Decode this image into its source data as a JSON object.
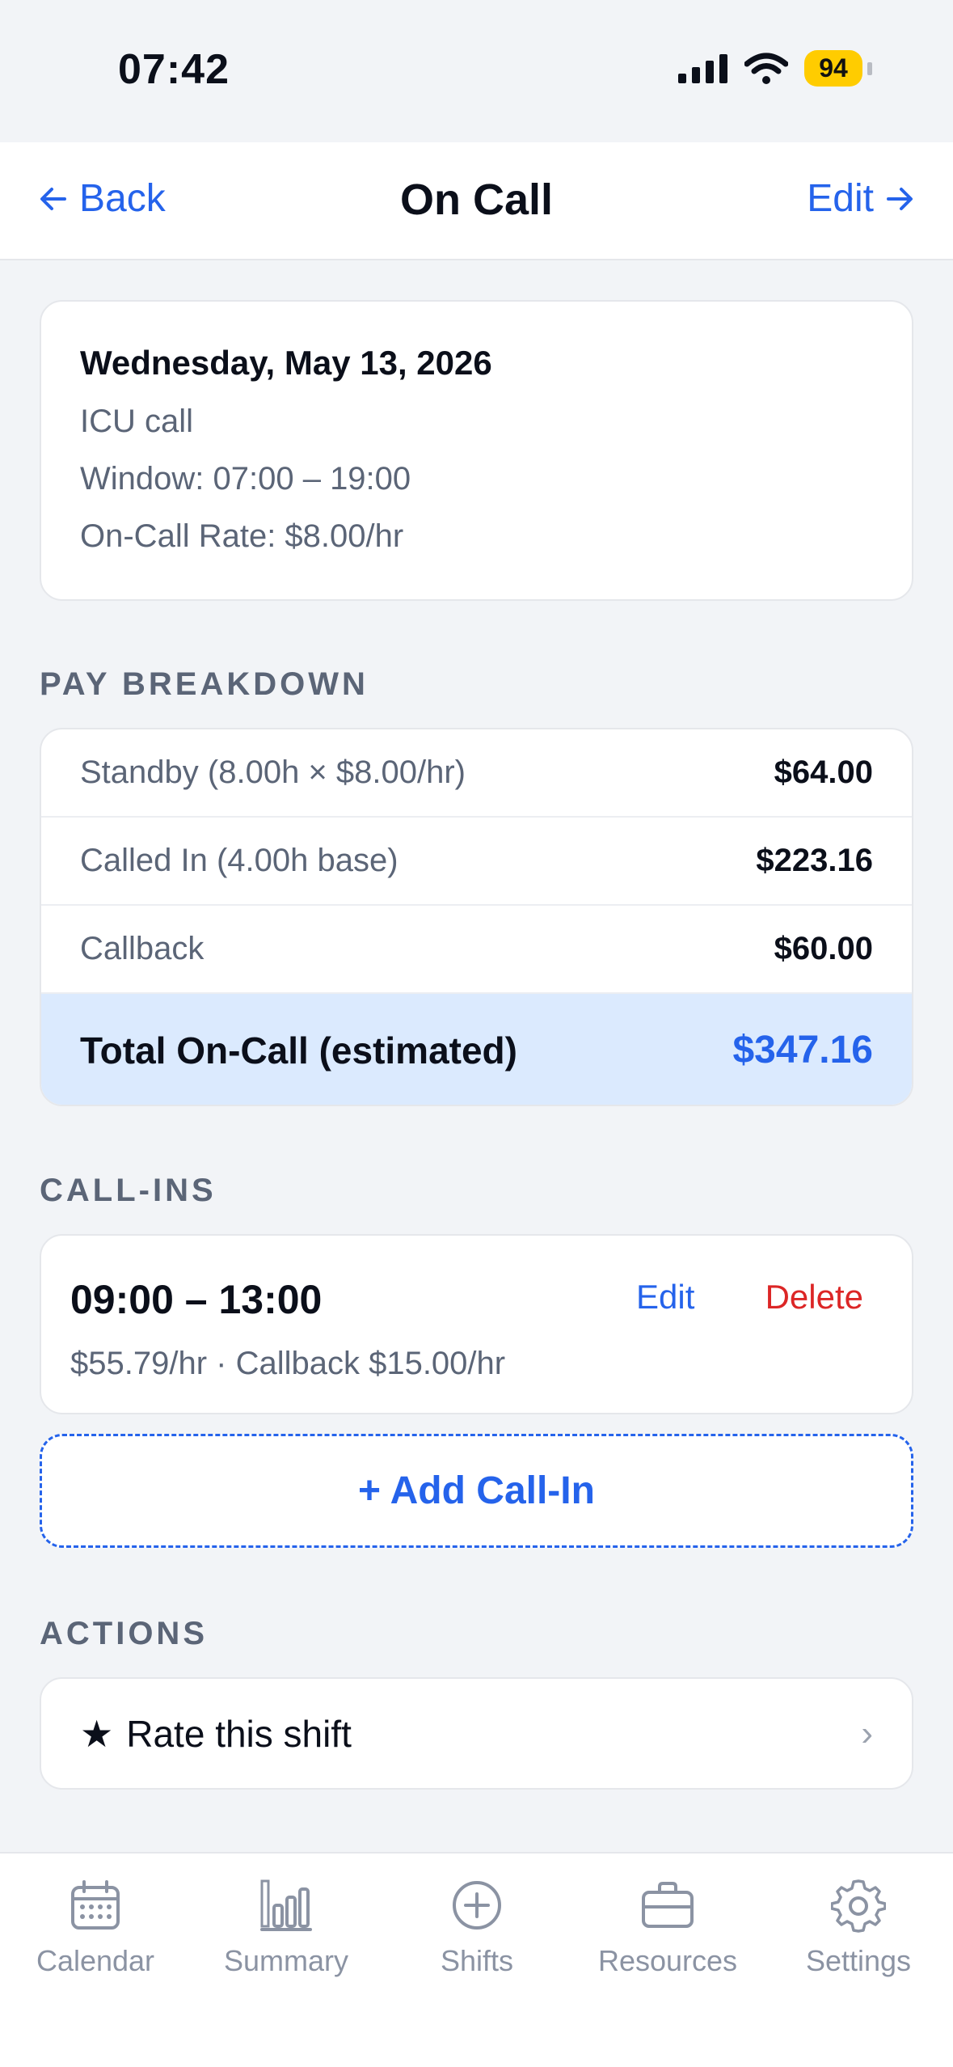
{
  "status_bar": {
    "time": "07:42",
    "battery": "94"
  },
  "nav": {
    "back_label": "Back",
    "title": "On Call",
    "edit_label": "Edit"
  },
  "info": {
    "date": "Wednesday, May 13, 2026",
    "name": "ICU call",
    "window": "Window: 07:00 – 19:00",
    "rate": "On-Call Rate: $8.00/hr"
  },
  "pay_breakdown": {
    "header": "PAY BREAKDOWN",
    "rows": [
      {
        "label": "Standby (8.00h × $8.00/hr)",
        "value": "$64.00"
      },
      {
        "label": "Called In (4.00h base)",
        "value": "$223.16"
      },
      {
        "label": "Callback",
        "value": "$60.00"
      }
    ],
    "total_label": "Total On-Call (estimated)",
    "total_value": "$347.16"
  },
  "call_ins": {
    "header": "CALL-INS",
    "items": [
      {
        "time": "09:00 – 13:00",
        "details": "$55.79/hr · Callback $15.00/hr",
        "edit_label": "Edit",
        "delete_label": "Delete"
      }
    ],
    "add_label": "+ Add Call-In"
  },
  "actions": {
    "header": "ACTIONS",
    "rate_label": "Rate this shift",
    "rate_icon": "star-icon"
  },
  "tabs": [
    {
      "label": "Calendar",
      "icon": "calendar-icon"
    },
    {
      "label": "Summary",
      "icon": "bar-chart-icon"
    },
    {
      "label": "Shifts",
      "icon": "plus-circle-icon"
    },
    {
      "label": "Resources",
      "icon": "briefcase-icon"
    },
    {
      "label": "Settings",
      "icon": "gear-icon"
    }
  ],
  "colors": {
    "accent": "#2563eb",
    "danger": "#dc2626",
    "total_bg": "#dbeafe",
    "battery": "#ffcc00"
  }
}
